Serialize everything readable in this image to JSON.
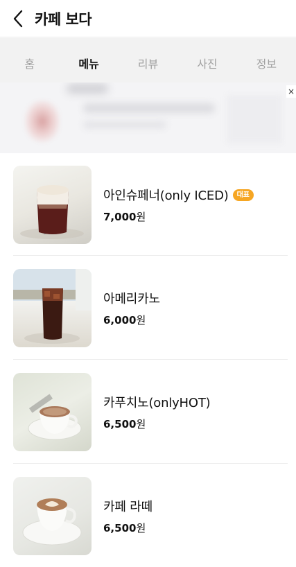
{
  "header": {
    "title": "카페 보다"
  },
  "tabs": [
    {
      "label": "홈",
      "active": false
    },
    {
      "label": "메뉴",
      "active": true
    },
    {
      "label": "리뷰",
      "active": false
    },
    {
      "label": "사진",
      "active": false
    },
    {
      "label": "정보",
      "active": false
    }
  ],
  "banner": {
    "close_label": "×"
  },
  "menu": [
    {
      "name": "아인슈페너(only ICED)",
      "badge": "대표",
      "price_number": "7,000",
      "price_unit": "원",
      "image": "iced-einspanner-photo"
    },
    {
      "name": "아메리카노",
      "badge": "",
      "price_number": "6,000",
      "price_unit": "원",
      "image": "iced-americano-photo"
    },
    {
      "name": "카푸치노(onlyHOT)",
      "badge": "",
      "price_number": "6,500",
      "price_unit": "원",
      "image": "cappuccino-photo"
    },
    {
      "name": "카페 라떼",
      "badge": "",
      "price_number": "6,500",
      "price_unit": "원",
      "image": "cafe-latte-photo"
    }
  ],
  "colors": {
    "badge": "#f6a623",
    "tab_bg": "#f2f2f2",
    "active_tab": "#111111",
    "inactive_tab": "#a0a0a0"
  }
}
